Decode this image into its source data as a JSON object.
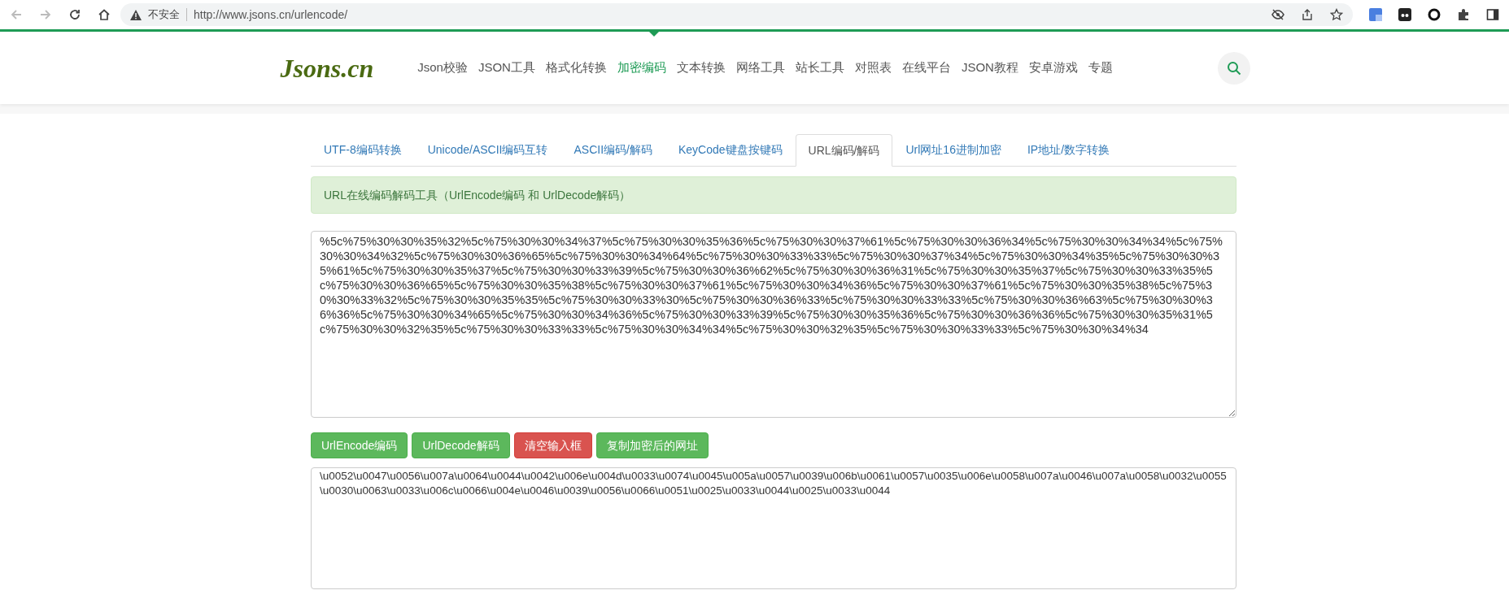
{
  "browser": {
    "security_label": "不安全",
    "url": "http://www.jsons.cn/urlencode/"
  },
  "header": {
    "logo": "Jsons.cn",
    "nav": [
      {
        "label": "Json校验",
        "selected": false
      },
      {
        "label": "JSON工具",
        "selected": false
      },
      {
        "label": "格式化转换",
        "selected": false
      },
      {
        "label": "加密编码",
        "selected": true
      },
      {
        "label": "文本转换",
        "selected": false
      },
      {
        "label": "网络工具",
        "selected": false
      },
      {
        "label": "站长工具",
        "selected": false
      },
      {
        "label": "对照表",
        "selected": false
      },
      {
        "label": "在线平台",
        "selected": false
      },
      {
        "label": "JSON教程",
        "selected": false
      },
      {
        "label": "安卓游戏",
        "selected": false
      },
      {
        "label": "专题",
        "selected": false
      }
    ]
  },
  "tabs": [
    {
      "label": "UTF-8编码转换",
      "selected": false
    },
    {
      "label": "Unicode/ASCII编码互转",
      "selected": false
    },
    {
      "label": "ASCII编码/解码",
      "selected": false
    },
    {
      "label": "KeyCode键盘按键码",
      "selected": false
    },
    {
      "label": "URL编码/解码",
      "selected": true
    },
    {
      "label": "Url网址16进制加密",
      "selected": false
    },
    {
      "label": "IP地址/数字转换",
      "selected": false
    }
  ],
  "alert": "URL在线编码解码工具（UrlEncode编码 和 UrlDecode解码）",
  "input": "%5c%75%30%30%35%32%5c%75%30%30%34%37%5c%75%30%30%35%36%5c%75%30%30%37%61%5c%75%30%30%36%34%5c%75%30%30%34%34%5c%75%30%30%34%32%5c%75%30%30%36%65%5c%75%30%30%34%64%5c%75%30%30%33%33%5c%75%30%30%37%34%5c%75%30%30%34%35%5c%75%30%30%35%61%5c%75%30%30%35%37%5c%75%30%30%33%39%5c%75%30%30%36%62%5c%75%30%30%36%31%5c%75%30%30%35%37%5c%75%30%30%33%35%5c%75%30%30%36%65%5c%75%30%30%35%38%5c%75%30%30%37%61%5c%75%30%30%34%36%5c%75%30%30%37%61%5c%75%30%30%35%38%5c%75%30%30%33%32%5c%75%30%30%35%35%5c%75%30%30%33%30%5c%75%30%30%36%33%5c%75%30%30%33%33%5c%75%30%30%36%63%5c%75%30%30%36%36%5c%75%30%30%34%65%5c%75%30%30%34%36%5c%75%30%30%33%39%5c%75%30%30%35%36%5c%75%30%30%36%36%5c%75%30%30%35%31%5c%75%30%30%32%35%5c%75%30%30%33%33%5c%75%30%30%34%34%5c%75%30%30%32%35%5c%75%30%30%33%33%5c%75%30%30%34%34",
  "buttons": [
    {
      "label": "UrlEncode编码",
      "kind": "success"
    },
    {
      "label": "UrlDecode解码",
      "kind": "success"
    },
    {
      "label": "清空输入框",
      "kind": "danger"
    },
    {
      "label": "复制加密后的网址",
      "kind": "success"
    }
  ],
  "output": "\\u0052\\u0047\\u0056\\u007a\\u0064\\u0044\\u0042\\u006e\\u004d\\u0033\\u0074\\u0045\\u005a\\u0057\\u0039\\u006b\\u0061\\u0057\\u0035\\u006e\\u0058\\u007a\\u0046\\u007a\\u0058\\u0032\\u0055\\u0030\\u0063\\u0033\\u006c\\u0066\\u004e\\u0046\\u0039\\u0056\\u0066\\u0051\\u0025\\u0033\\u0044\\u0025\\u0033\\u0044"
}
